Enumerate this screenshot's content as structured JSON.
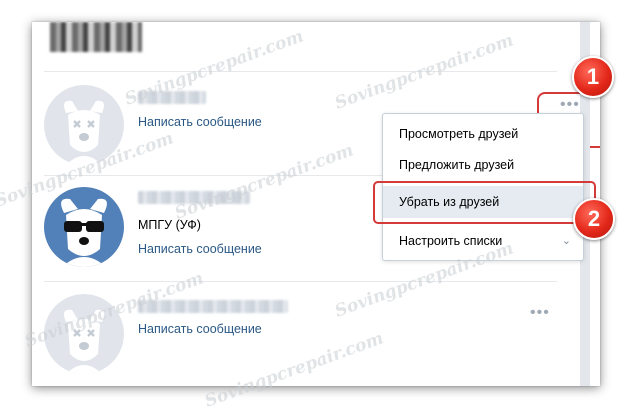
{
  "friends": [
    {
      "subtitle": "",
      "message_link": "Написать сообщение",
      "avatar": "default-dog-avatar"
    },
    {
      "subtitle": "МПГУ (УФ)",
      "message_link": "Написать сообщение",
      "avatar": "dog-sunglasses-avatar"
    },
    {
      "subtitle": "",
      "message_link": "Написать сообщение",
      "avatar": "default-dog-avatar"
    }
  ],
  "actions_menu": {
    "trigger": "•••",
    "items": [
      {
        "label": "Просмотреть друзей"
      },
      {
        "label": "Предложить друзей"
      },
      {
        "label": "Убрать из друзей"
      },
      {
        "label": "Настроить списки"
      }
    ],
    "chevron": "⌄"
  },
  "annotations": {
    "step1": "1",
    "step2": "2"
  },
  "watermark": "Sovingpcrepair.com",
  "colors": {
    "link": "#2a5885",
    "highlight": "#d53a3a",
    "active_item": "#e5ebf1",
    "avatar_bg": "#e1e5eb",
    "avatar_blue": "#5181b8"
  }
}
